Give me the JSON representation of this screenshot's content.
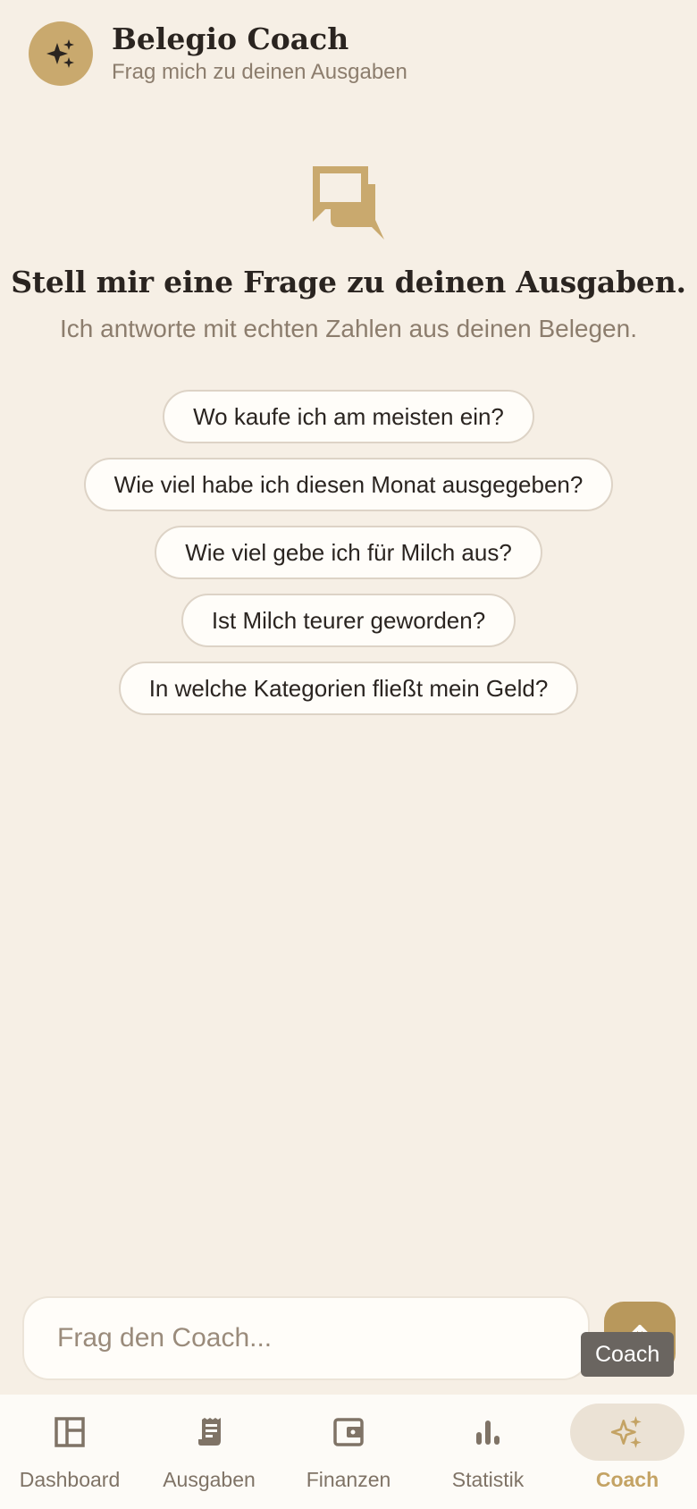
{
  "header": {
    "title": "Belegio Coach",
    "subtitle": "Frag mich zu deinen Ausgaben",
    "avatar_icon": "sparkles-icon"
  },
  "empty_state": {
    "icon": "chat-bubbles-icon",
    "title": "Stell mir eine Frage zu deinen Ausgaben.",
    "subtitle": "Ich antworte mit echten Zahlen aus deinen Belegen."
  },
  "suggestions": [
    "Wo kaufe ich am meisten ein?",
    "Wie viel habe ich diesen Monat ausgegeben?",
    "Wie viel gebe ich für Milch aus?",
    "Ist Milch teurer geworden?",
    "In welche Kategorien fließt mein Geld?"
  ],
  "composer": {
    "placeholder": "Frag den Coach...",
    "value": "",
    "send_icon": "arrow-up-icon",
    "tooltip": "Coach"
  },
  "nav": [
    {
      "label": "Dashboard",
      "icon": "dashboard-icon",
      "active": false
    },
    {
      "label": "Ausgaben",
      "icon": "receipt-icon",
      "active": false
    },
    {
      "label": "Finanzen",
      "icon": "wallet-icon",
      "active": false
    },
    {
      "label": "Statistik",
      "icon": "bar-chart-icon",
      "active": false
    },
    {
      "label": "Coach",
      "icon": "sparkles-icon",
      "active": true
    }
  ],
  "colors": {
    "background": "#f6efe5",
    "accent": "#c9a96e",
    "text": "#2a2420",
    "muted": "#8c7d6d"
  }
}
